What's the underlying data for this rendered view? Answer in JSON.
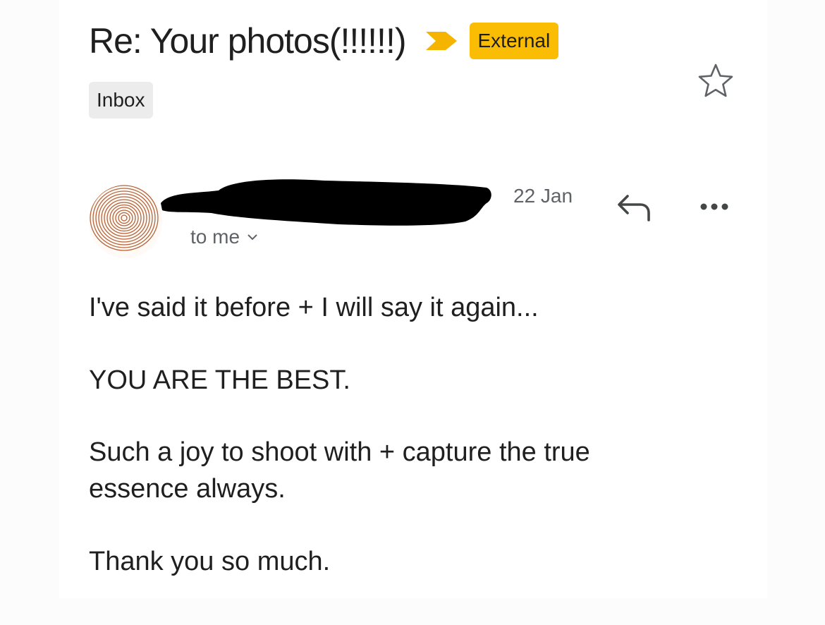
{
  "email": {
    "subject": "Re: Your photos(!!!!!!)",
    "labels": {
      "external": "External",
      "inbox": "Inbox"
    },
    "recipient": "to me",
    "date": "22 Jan",
    "body": [
      "I've said it before + I will say it again...",
      "YOU ARE THE BEST.",
      "Such a joy to shoot with + capture the true essence always.",
      "Thank you so much."
    ]
  },
  "icons": {
    "importance": "importance-marker-icon",
    "star": "star-outline-icon",
    "reply": "reply-icon",
    "more": "more-horiz-icon",
    "chevron": "chevron-down-icon",
    "avatar": "fingerprint-avatar"
  },
  "colors": {
    "external_label": "#fbbc04",
    "inbox_label": "#ececec",
    "importance": "#f4b400",
    "avatar_rings": "#b5643b",
    "secondary_text": "#5f6368"
  }
}
